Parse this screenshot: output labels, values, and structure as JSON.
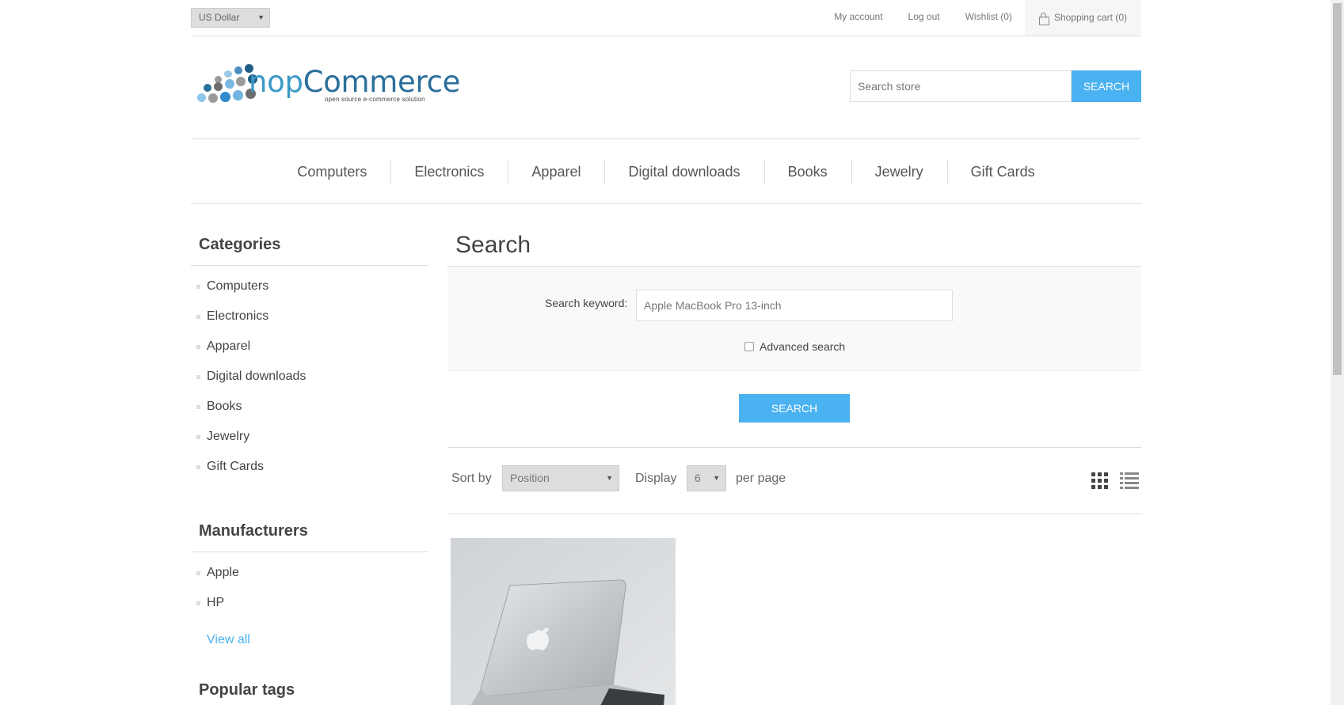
{
  "header": {
    "currency": "US Dollar",
    "links": {
      "my_account": "My account",
      "log_out": "Log out",
      "wishlist": "Wishlist (0)",
      "cart": "Shopping cart (0)"
    }
  },
  "logo": {
    "name_part1": "nop",
    "name_part2": "Commerce",
    "tagline": "open source e-commerce solution"
  },
  "search_store": {
    "placeholder": "Search store",
    "button": "Search"
  },
  "top_menu": [
    "Computers",
    "Electronics",
    "Apparel",
    "Digital downloads",
    "Books",
    "Jewelry",
    "Gift Cards"
  ],
  "sidebar": {
    "categories": {
      "title": "Categories",
      "items": [
        "Computers",
        "Electronics",
        "Apparel",
        "Digital downloads",
        "Books",
        "Jewelry",
        "Gift Cards"
      ]
    },
    "manufacturers": {
      "title": "Manufacturers",
      "items": [
        "Apple",
        "HP"
      ],
      "view_all": "View all"
    },
    "popular_tags": {
      "title": "Popular tags"
    }
  },
  "main": {
    "title": "Search",
    "keyword_label": "Search keyword:",
    "keyword_value": "Apple MacBook Pro 13-inch",
    "advanced_search": "Advanced search",
    "advanced_checked": false,
    "search_button": "Search",
    "sort_by_label": "Sort by",
    "sort_by_value": "Position",
    "display_label": "Display",
    "display_value": "6",
    "per_page_label": "per page"
  },
  "colors": {
    "accent": "#4ab2f1",
    "logo_dark": "#2a6f9b",
    "logo_light": "#3c99c6"
  }
}
